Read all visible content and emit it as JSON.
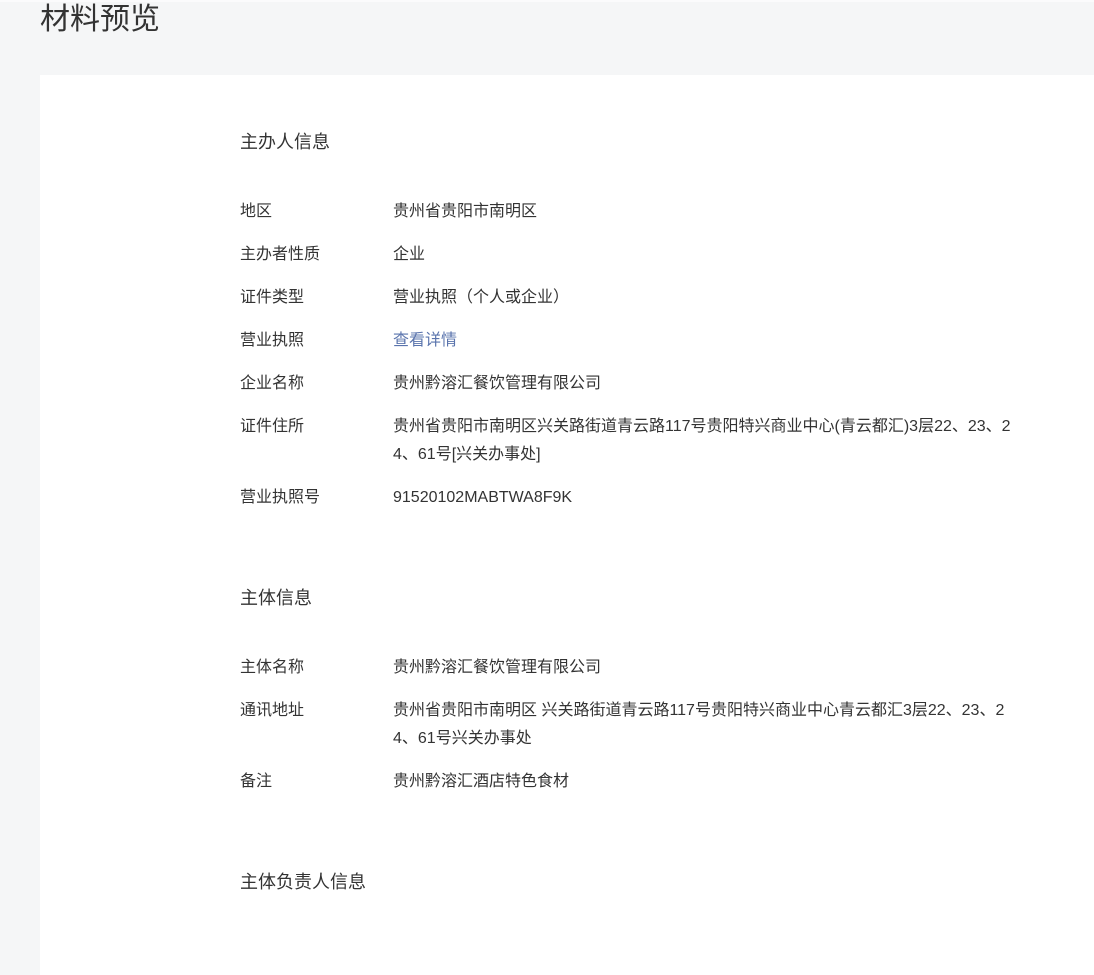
{
  "page": {
    "title": "材料预览"
  },
  "sections": [
    {
      "heading": "主办人信息",
      "rows": [
        {
          "label": "地区",
          "value": "贵州省贵阳市南明区"
        },
        {
          "label": "主办者性质",
          "value": "企业"
        },
        {
          "label": "证件类型",
          "value": "营业执照（个人或企业）"
        },
        {
          "label": "营业执照",
          "value": "查看详情"
        },
        {
          "label": "企业名称",
          "value": "贵州黔溶汇餐饮管理有限公司"
        },
        {
          "label": "证件住所",
          "value": "贵州省贵阳市南明区兴关路街道青云路117号贵阳特兴商业中心(青云都汇)3层22、23、24、61号[兴关办事处]"
        },
        {
          "label": "营业执照号",
          "value": "91520102MABTWA8F9K"
        }
      ]
    },
    {
      "heading": "主体信息",
      "rows": [
        {
          "label": "主体名称",
          "value": "贵州黔溶汇餐饮管理有限公司"
        },
        {
          "label": "通讯地址",
          "value": "贵州省贵阳市南明区 兴关路街道青云路117号贵阳特兴商业中心青云都汇3层22、23、24、61号兴关办事处"
        },
        {
          "label": "备注",
          "value": "贵州黔溶汇酒店特色食材"
        }
      ]
    },
    {
      "heading": "主体负责人信息",
      "rows": []
    }
  ],
  "colors": {
    "page_background": "#f5f6f7",
    "card_background": "#ffffff",
    "text": "#333333",
    "link": "#5a74ad"
  }
}
